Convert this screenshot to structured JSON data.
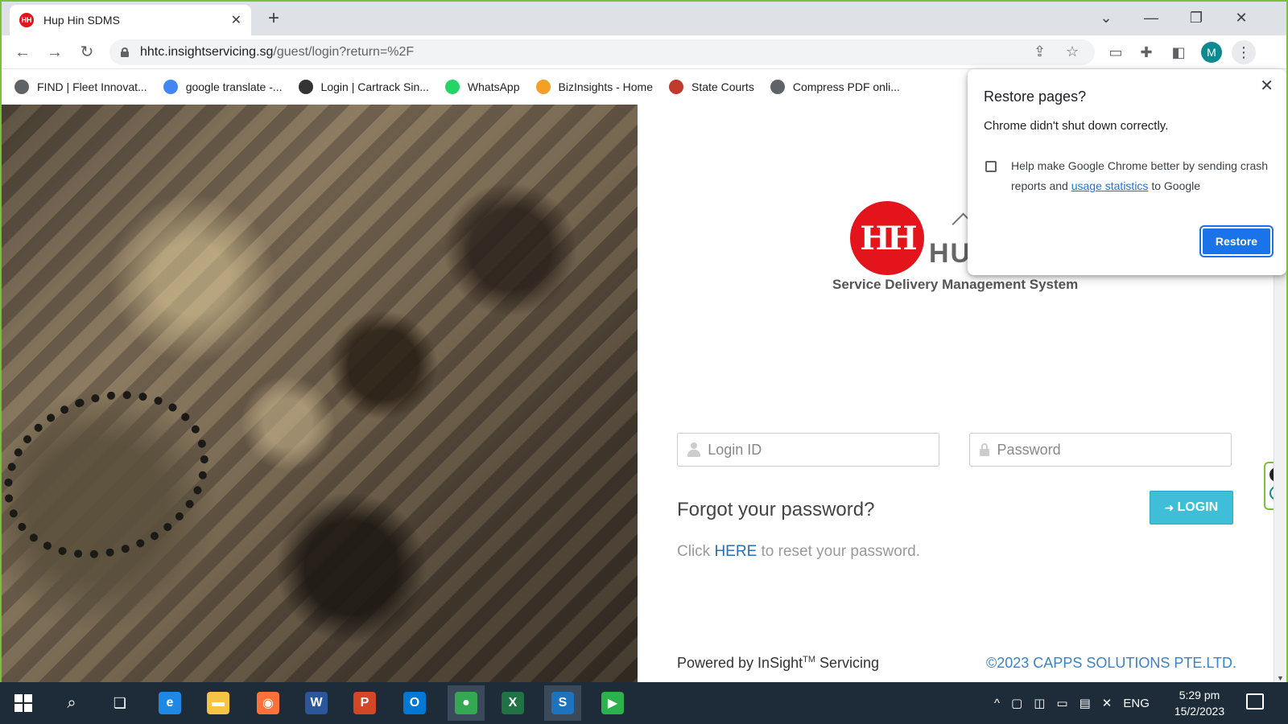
{
  "browser": {
    "tab_title": "Hup Hin SDMS",
    "tab_favicon": "HH",
    "url_host": "hhtc.insightservicing.sg",
    "url_path": "/guest/login?return=%2F",
    "profile_initial": "M"
  },
  "bookmarks": [
    {
      "label": "FIND | Fleet Innovat...",
      "color": "#5f6368"
    },
    {
      "label": "google translate -...",
      "color": "#4285f4"
    },
    {
      "label": "Login | Cartrack Sin...",
      "color": "#333333"
    },
    {
      "label": "WhatsApp",
      "color": "#25d366"
    },
    {
      "label": "BizInsights - Home",
      "color": "#f4a024"
    },
    {
      "label": "State Courts",
      "color": "#c0392b"
    },
    {
      "label": "Compress PDF onli...",
      "color": "#5f6368"
    }
  ],
  "login": {
    "logo_mark": "HH",
    "logo_text": "HU",
    "tagline": "Service Delivery Management System",
    "login_id_placeholder": "Login ID",
    "password_placeholder": "Password",
    "forgot_heading": "Forgot your password?",
    "reset_prefix": "Click",
    "reset_link": "HERE",
    "reset_suffix": "to reset your password.",
    "login_button": "LOGIN",
    "powered_prefix": "Powered by InSight",
    "powered_tm": "TM",
    "powered_suffix": "Servicing",
    "copyright": "©2023 CAPPS SOLUTIONS PTE.LTD."
  },
  "restore_popup": {
    "title": "Restore pages?",
    "message": "Chrome didn't shut down correctly.",
    "help_prefix": "Help make Google Chrome better by sending crash reports and",
    "help_link": "usage statistics",
    "help_suffix": "to Google",
    "restore_button": "Restore",
    "checked": false
  },
  "taskbar": {
    "language": "ENG",
    "time": "5:29 pm",
    "date": "15/2/2023",
    "apps": [
      {
        "name": "edge",
        "glyph": "e",
        "color": "#1e88e5"
      },
      {
        "name": "file-explorer",
        "glyph": "▬",
        "color": "#f6c343"
      },
      {
        "name": "firefox",
        "glyph": "◉",
        "color": "#ff7139"
      },
      {
        "name": "word",
        "glyph": "W",
        "color": "#2b579a"
      },
      {
        "name": "powerpoint",
        "glyph": "P",
        "color": "#d24726"
      },
      {
        "name": "outlook",
        "glyph": "O",
        "color": "#0078d4"
      },
      {
        "name": "chrome",
        "glyph": "●",
        "color": "#34a853"
      },
      {
        "name": "excel",
        "glyph": "X",
        "color": "#217346"
      },
      {
        "name": "insight-app",
        "glyph": "S",
        "color": "#1e73be"
      },
      {
        "name": "media-player",
        "glyph": "▶",
        "color": "#2bb24c"
      }
    ]
  }
}
